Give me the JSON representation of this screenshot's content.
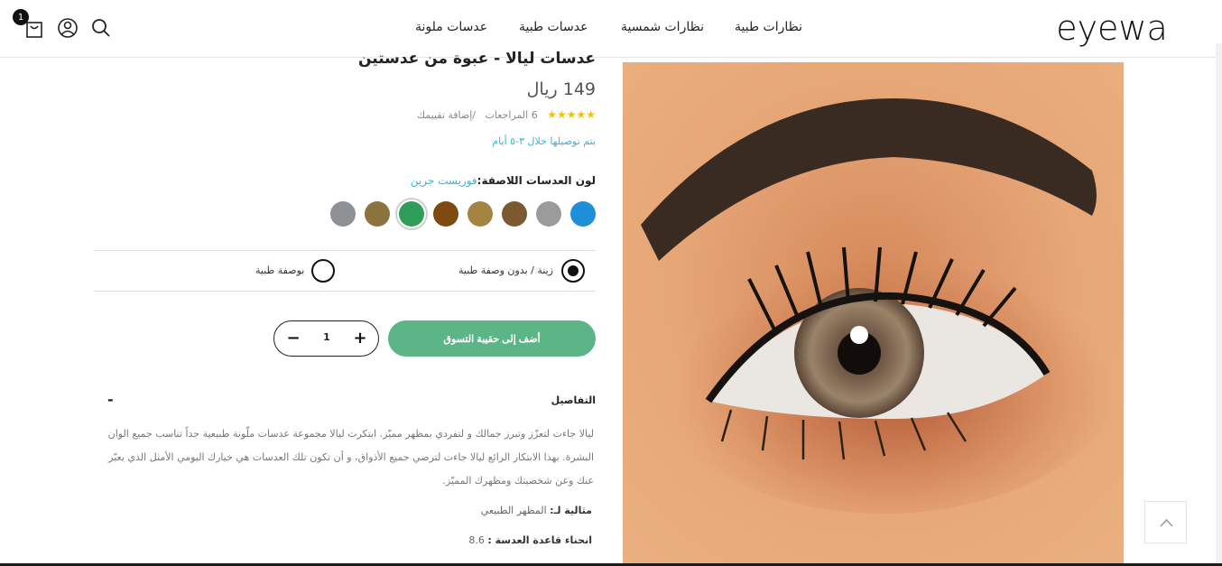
{
  "header": {
    "logo_text": "eyewa",
    "nav": [
      "نظارات طبية",
      "نظارات شمسية",
      "عدسات طبية",
      "عدسات ملونة"
    ],
    "icons": [
      "search-icon",
      "user-icon",
      "cart-icon"
    ],
    "cart_count": "1"
  },
  "product": {
    "title": "عدسات ليالا - عبوة من عدستين",
    "price": "149 ريال",
    "rating_stars": "★★★★★",
    "reviews": "6 المراجعات",
    "add_review": "/إضافة تقييمك",
    "delivery": "يتم توصيلها خلال ٣-٥ أيام",
    "color_label": "لون العدسات اللاصقة:",
    "color_value": "فوريست جرين",
    "swatches": [
      "#1e8fd8",
      "#9b9b9b",
      "#7b5a32",
      "#a38443",
      "#7d4a10",
      "#2f9e58",
      "#8a733f",
      "#8e9194"
    ],
    "selected_swatch": 5,
    "options": [
      {
        "label": "زينة / بدون وصفة طبية",
        "checked": true
      },
      {
        "label": "بوصفة طبية",
        "checked": false
      }
    ],
    "add_to_bag": "أضف إلى حقيبة التسوق",
    "quantity": "1",
    "qty_minus": "−",
    "qty_plus": "+"
  },
  "details": {
    "heading": "التفاصيل",
    "toggle": "-",
    "description": "ليالا جاءت لتعزّز وتبرز جمالك و لتفردي بمظهر مميّز. ابتكرت ليالا مجموعة عدسات ملّونة طبيعية جداً تناسب جميع الوان البشرة. بهذا الابتكار الرائع ليالا جاءت لترضي جميع الأذواق، و أن تكون تلك العدسات هي خيارك اليومي الأمثل الذي يعبّر عنك وعن شخصيتك ومظهرك المميّز.",
    "spec1_label": "مثالية لـ:",
    "spec1_value": " المظهر الطبيعي",
    "spec2_label": "انحناء قاعدة العدسة :",
    "spec2_value": " 8.6"
  },
  "colors": {
    "accent_green": "#5cb587",
    "link_blue": "#3bb3d6",
    "star_yellow": "#f2c200"
  }
}
